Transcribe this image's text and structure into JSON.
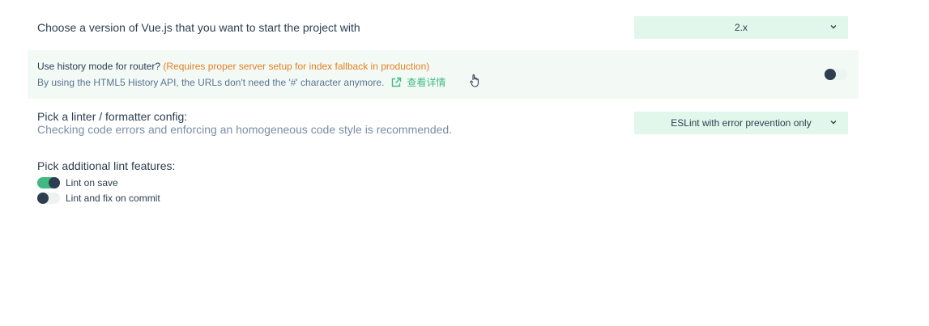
{
  "vue_version": {
    "label": "Choose a version of Vue.js that you want to start the project with",
    "selected": "2.x"
  },
  "history_mode": {
    "question": "Use history mode for router? ",
    "warning": "(Requires proper server setup for index fallback in production)",
    "description": "By using the HTML5 History API, the URLs don't need the '#' character anymore.",
    "link_label": "查看详情",
    "enabled": false
  },
  "linter": {
    "label": "Pick a linter / formatter config:",
    "description": "Checking code errors and enforcing an homogeneous code style is recommended.",
    "selected": "ESLint with error prevention only"
  },
  "lint_features": {
    "label": "Pick additional lint features:",
    "items": [
      {
        "label": "Lint on save",
        "enabled": true
      },
      {
        "label": "Lint and fix on commit",
        "enabled": false
      }
    ]
  },
  "colors": {
    "accent": "#42b983",
    "warning": "#e67e22",
    "select_bg": "#e2f7ec",
    "highlight_bg": "#f3faf6"
  }
}
